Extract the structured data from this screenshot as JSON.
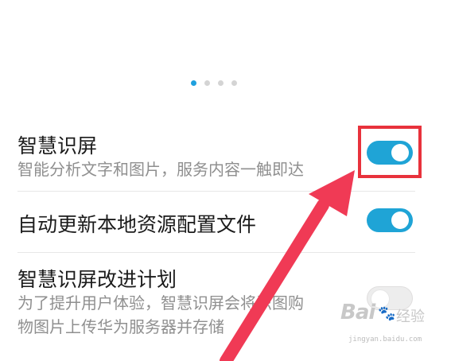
{
  "pager": {
    "count": 4,
    "active_index": 0
  },
  "settings": [
    {
      "title": "智慧识屏",
      "subtitle_lines": [
        "智能分析文字和图片，服务内容一触即达"
      ],
      "enabled": true
    },
    {
      "title": "自动更新本地资源配置文件",
      "subtitle_lines": [],
      "enabled": true
    },
    {
      "title": "智慧识屏改进计划",
      "subtitle_lines": [
        "为了提升用户体验，智慧识屏会将识图购",
        "物图片上传华为服务器并存储"
      ],
      "enabled": false
    }
  ],
  "annotation": {
    "highlight_color": "#e8323c",
    "arrow_color": "#f03a55"
  },
  "watermark": {
    "logo": "Bai",
    "logo_suffix": "du",
    "cn": "经验",
    "url": "jingyan.baidu.com"
  },
  "colors": {
    "toggle_on": "#1fa4d6",
    "toggle_off": "#ededed",
    "pager_active": "#1fa0de"
  }
}
